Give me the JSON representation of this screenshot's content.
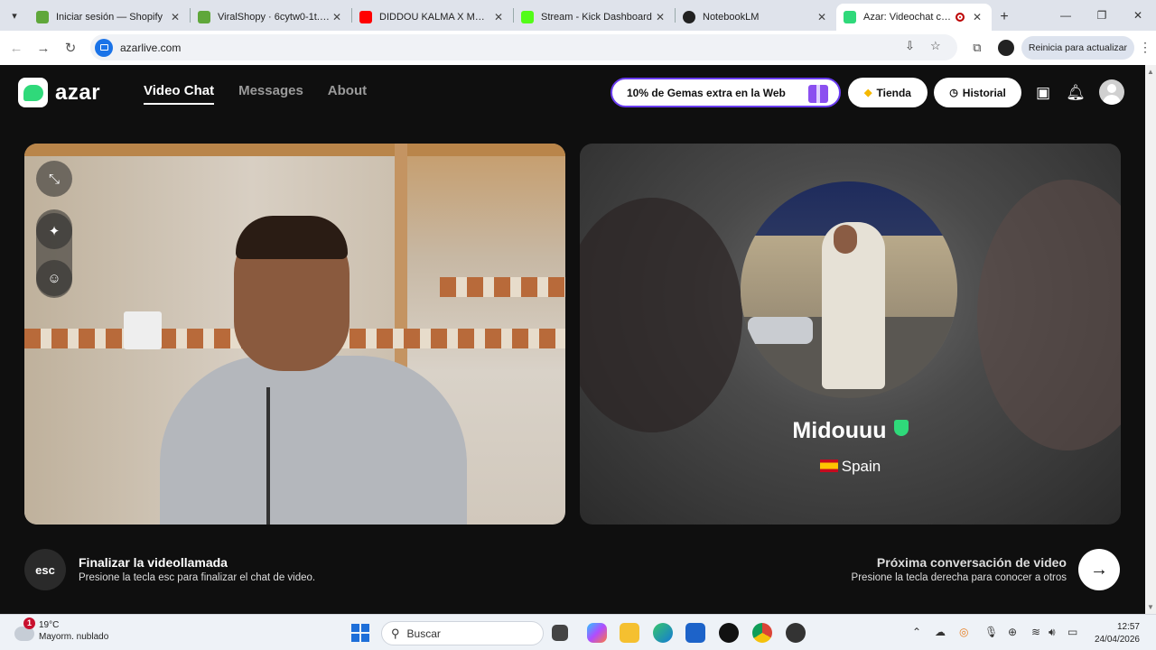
{
  "browser": {
    "tabs": [
      {
        "title": "Iniciar sesión — Shopify",
        "favicon_color": "#5fa73a"
      },
      {
        "title": "ViralShopy · 6cytw0-1t.mys",
        "favicon_color": "#5fa73a"
      },
      {
        "title": "DIDDOU KALMA X MORO...",
        "favicon_color": "#ff0000"
      },
      {
        "title": "Stream - Kick Dashboard",
        "favicon_color": "#53fc18"
      },
      {
        "title": "NotebookLM",
        "favicon_color": "#222222"
      },
      {
        "title": "Azar: Videochat con ge",
        "favicon_color": "#2fd97a",
        "active": true
      }
    ],
    "url": "azarlive.com",
    "update_label": "Reinicia para actualizar"
  },
  "site": {
    "logo_text": "azar",
    "nav": [
      {
        "label": "Video Chat",
        "active": true
      },
      {
        "label": "Messages",
        "active": false
      },
      {
        "label": "About",
        "active": false
      }
    ],
    "promo_label": "10% de Gemas extra en la Web",
    "store_label": "Tienda",
    "history_label": "Historial"
  },
  "peer": {
    "name": "Midouuu",
    "country": "Spain"
  },
  "controls": {
    "esc_key": "esc",
    "end_title": "Finalizar la videollamada",
    "end_desc": "Presione la tecla esc para finalizar el chat de video.",
    "next_title": "Próxima conversación de video",
    "next_desc": "Presione la tecla derecha para conocer a otros"
  },
  "taskbar": {
    "weather_badge": "1",
    "temperature": "19°C",
    "weather_desc": "Mayorm. nublado",
    "search_placeholder": "Buscar",
    "time": "12:57",
    "date": "24/04/2026"
  },
  "colors": {
    "accent_green": "#2fd97a",
    "promo_border": "#6a3cf0",
    "page_bg": "#0f0f0f"
  }
}
